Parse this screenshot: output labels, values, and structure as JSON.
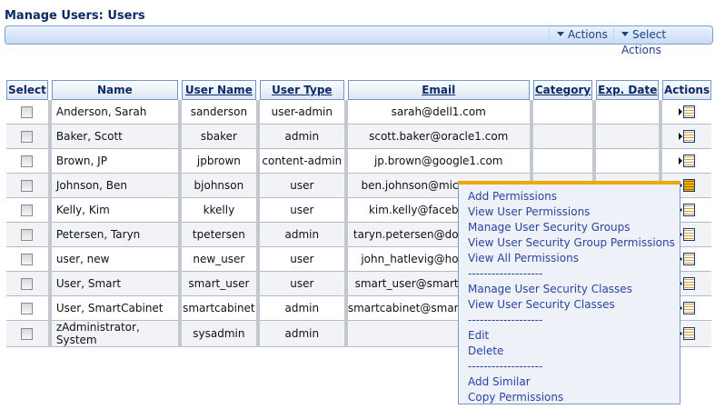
{
  "page": {
    "title": "Manage Users: Users"
  },
  "toolbar": {
    "actions": "Actions",
    "select_actions": "Select Actions"
  },
  "table": {
    "headers": [
      "Select",
      "Name",
      "User Name",
      "User Type",
      "Email",
      "Category",
      "Exp. Date",
      "Actions"
    ],
    "rows": [
      {
        "name": "Anderson, Sarah",
        "username": "sanderson",
        "type": "user-admin",
        "email": "sarah@dell1.com",
        "category": "",
        "exp": ""
      },
      {
        "name": "Baker, Scott",
        "username": "sbaker",
        "type": "admin",
        "email": "scott.baker@oracle1.com",
        "category": "",
        "exp": ""
      },
      {
        "name": "Brown, JP",
        "username": "jpbrown",
        "type": "content-admin",
        "email": "jp.brown@google1.com",
        "category": "",
        "exp": ""
      },
      {
        "name": "Johnson, Ben",
        "username": "bjohnson",
        "type": "user",
        "email": "ben.johnson@mic",
        "category": "",
        "exp": ""
      },
      {
        "name": "Kelly, Kim",
        "username": "kkelly",
        "type": "user",
        "email": "kim.kelly@faceb",
        "category": "",
        "exp": ""
      },
      {
        "name": "Petersen, Taryn",
        "username": "tpetersen",
        "type": "admin",
        "email": "taryn.petersen@do",
        "category": "",
        "exp": ""
      },
      {
        "name": "user, new",
        "username": "new_user",
        "type": "user",
        "email": "john_hatlevig@ho",
        "category": "",
        "exp": ""
      },
      {
        "name": "User, Smart",
        "username": "smart_user",
        "type": "user",
        "email": "smart_user@smart",
        "category": "",
        "exp": ""
      },
      {
        "name": "User, SmartCabinet",
        "username": "smartcabinet",
        "type": "admin",
        "email": "smartcabinet@smar",
        "category": "",
        "exp": ""
      },
      {
        "name": "zAdministrator, System",
        "username": "sysadmin",
        "type": "admin",
        "email": "",
        "category": "",
        "exp": ""
      }
    ]
  },
  "menu": {
    "items": [
      "Add Permissions",
      "View User Permissions",
      "Manage User Security Groups",
      "View User Security Group Permissions",
      "View All Permissions",
      "-------------------",
      "Manage User Security Classes",
      "View User Security Classes",
      "-------------------",
      "Edit",
      "Delete",
      "-------------------",
      "Add Similar",
      "Copy Permissions"
    ]
  },
  "colors": {
    "accent": "#f0a800",
    "header_text": "#0b2a66",
    "link": "#2a44a0"
  }
}
